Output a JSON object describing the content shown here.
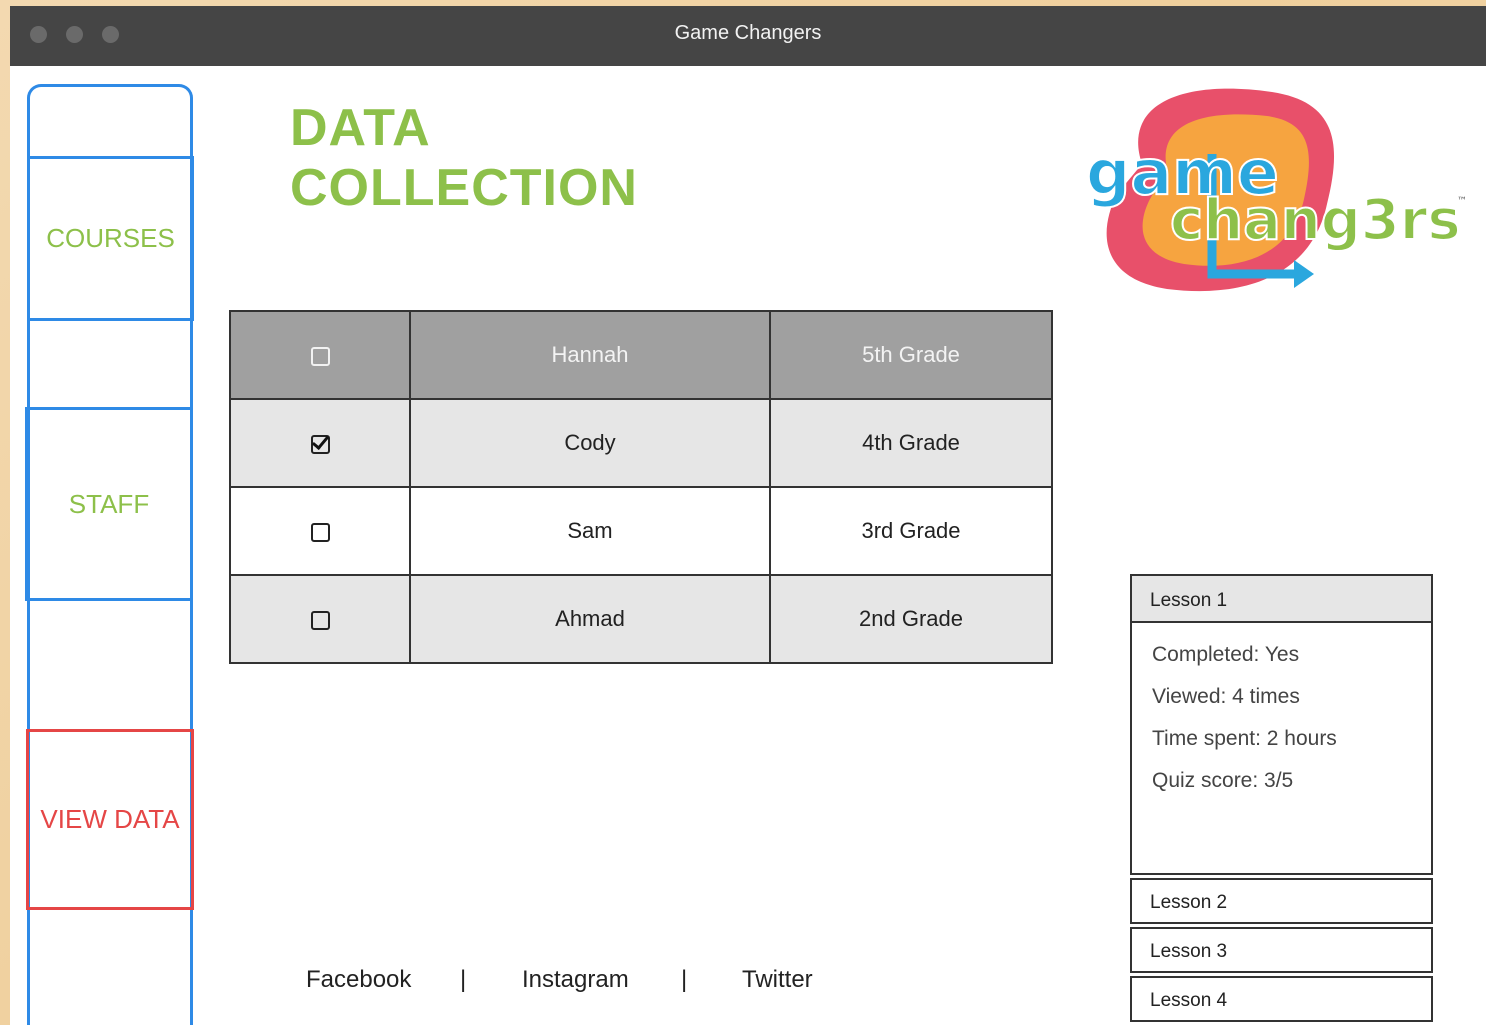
{
  "window": {
    "title": "Game Changers"
  },
  "sidebar": {
    "items": [
      {
        "label": "COURSES"
      },
      {
        "label": "STAFF"
      },
      {
        "label": "VIEW DATA"
      }
    ]
  },
  "main": {
    "title_line1": "DATA",
    "title_line2": "COLLECTION",
    "logo": {
      "line1": "game",
      "line2": "chang3rs",
      "tm": "™"
    }
  },
  "students": {
    "rows": [
      {
        "name": "Hannah",
        "grade": "5th Grade",
        "checked": false
      },
      {
        "name": "Cody",
        "grade": "4th Grade",
        "checked": true
      },
      {
        "name": "Sam",
        "grade": "3rd Grade",
        "checked": false
      },
      {
        "name": "Ahmad",
        "grade": "2nd Grade",
        "checked": false
      }
    ]
  },
  "lessons": {
    "expanded": {
      "title": "Lesson 1",
      "completed": "Completed: Yes",
      "viewed": "Viewed: 4 times",
      "time_spent": "Time  spent: 2 hours",
      "quiz_score": "Quiz score: 3/5"
    },
    "collapsed": [
      "Lesson 2",
      "Lesson 3",
      "Lesson 4"
    ]
  },
  "footer": {
    "facebook": "Facebook",
    "instagram": "Instagram",
    "twitter": "Twitter",
    "separator": "|"
  },
  "colors": {
    "accent_green": "#8dc04a",
    "accent_blue": "#2e8ae6",
    "accent_red": "#e54646",
    "titlebar": "#454545"
  }
}
